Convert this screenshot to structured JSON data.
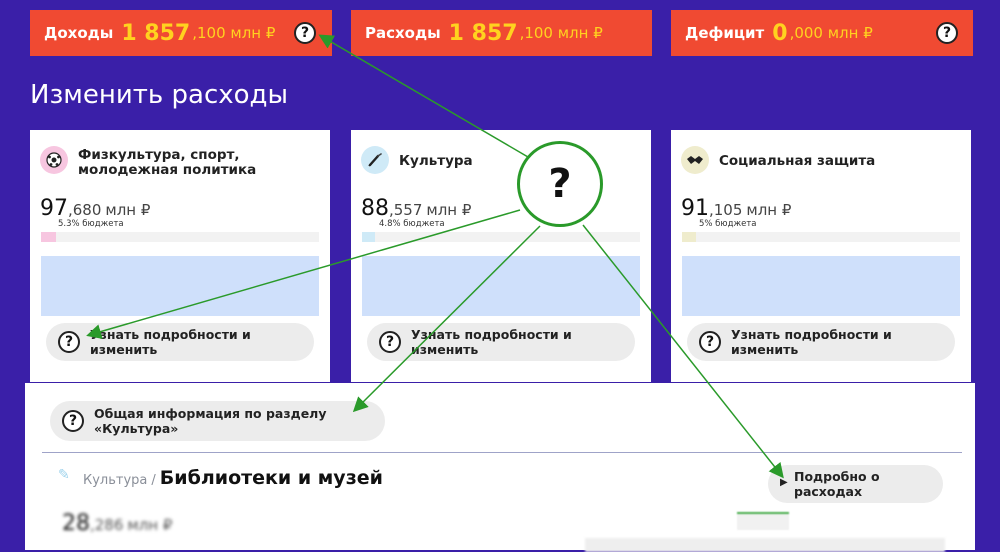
{
  "summary": [
    {
      "label": "Доходы",
      "big": "1 857",
      "small": ",100 млн ₽",
      "help": "?"
    },
    {
      "label": "Расходы",
      "big": "1 857",
      "small": ",100 млн ₽"
    },
    {
      "label": "Дефицит",
      "big": "0",
      "small": ",000 млн ₽",
      "help": "?"
    }
  ],
  "heading": "Изменить расходы",
  "cards": [
    {
      "title": "Физкультура, спорт, молодежная политика",
      "amount_int": "97",
      "amount_frac": ",680",
      "unit": "млн ₽",
      "pct": "5.3% бюджета",
      "share": 0.053,
      "button": "Узнать подробности и изменить",
      "help": "?",
      "icon": "ball-icon",
      "color": "#f7c6e0"
    },
    {
      "title": "Культура",
      "amount_int": "88",
      "amount_frac": ",557",
      "unit": "млн ₽",
      "pct": "4.8% бюджета",
      "share": 0.048,
      "button": "Узнать подробности и изменить",
      "help": "?",
      "icon": "brush-icon",
      "color": "#cfeaf7"
    },
    {
      "title": "Социальная защита",
      "amount_int": "91",
      "amount_frac": ",105",
      "unit": "млн ₽",
      "pct": "5% бюджета",
      "share": 0.05,
      "button": "Узнать подробности и изменить",
      "help": "?",
      "icon": "handshake-icon",
      "color": "#efeccd"
    }
  ],
  "general_button": "Общая информация по разделу «Культура»",
  "general_help": "?",
  "breadcrumb": {
    "parent": "Культура",
    "sep": "/",
    "current": "Библиотеки и музей"
  },
  "more_button": "Подробно о расходах",
  "sub_amount": {
    "int": "28",
    "frac": ",286",
    "unit": "млн ₽"
  },
  "callout": "?"
}
